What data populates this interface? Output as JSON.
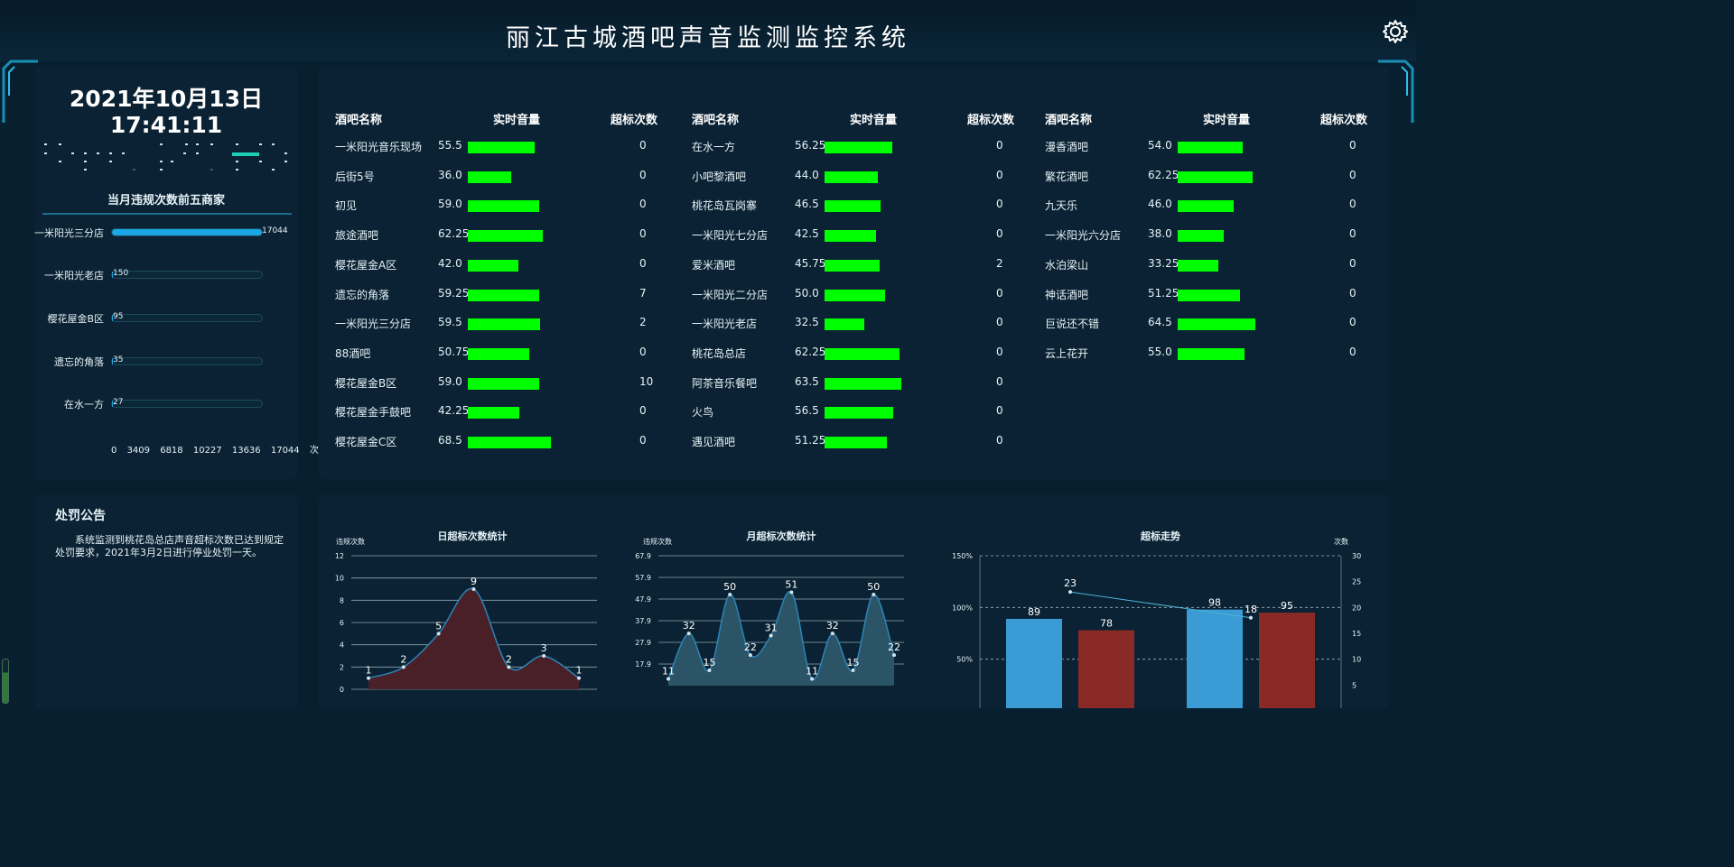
{
  "header": {
    "title": "丽江古城酒吧声音监测监控系统",
    "settings_icon": "gear-icon"
  },
  "clock": {
    "date": "2021年10月13日",
    "time": "17:41:11"
  },
  "top5": {
    "title": "当月违规次数前五商家",
    "items": [
      {
        "name": "一米阳光三分店",
        "value": 17044
      },
      {
        "name": "一米阳光老店",
        "value": 150
      },
      {
        "name": "樱花屋金B区",
        "value": 95
      },
      {
        "name": "遗忘的角落",
        "value": 35
      },
      {
        "name": "在水一方",
        "value": 27
      }
    ],
    "scale": [
      "0",
      "3409",
      "6818",
      "10227",
      "13636",
      "17044",
      "次"
    ]
  },
  "table": {
    "headers": {
      "name": "酒吧名称",
      "volume": "实时音量",
      "count": "超标次数"
    },
    "columns": [
      [
        {
          "name": "一米阳光音乐现场",
          "volume": "55.5",
          "count": "0"
        },
        {
          "name": "后街5号",
          "volume": "36.0",
          "count": "0"
        },
        {
          "name": "初见",
          "volume": "59.0",
          "count": "0"
        },
        {
          "name": "旅途酒吧",
          "volume": "62.25",
          "count": "0"
        },
        {
          "name": "樱花屋金A区",
          "volume": "42.0",
          "count": "0"
        },
        {
          "name": "遗忘的角落",
          "volume": "59.25",
          "count": "7"
        },
        {
          "name": "一米阳光三分店",
          "volume": "59.5",
          "count": "2"
        },
        {
          "name": "88酒吧",
          "volume": "50.75",
          "count": "0"
        },
        {
          "name": "樱花屋金B区",
          "volume": "59.0",
          "count": "10"
        },
        {
          "name": "樱花屋金手鼓吧",
          "volume": "42.25",
          "count": "0"
        },
        {
          "name": "樱花屋金C区",
          "volume": "68.5",
          "count": "0"
        }
      ],
      [
        {
          "name": "在水一方",
          "volume": "56.25",
          "count": "0"
        },
        {
          "name": "小吧黎酒吧",
          "volume": "44.0",
          "count": "0"
        },
        {
          "name": "桃花岛瓦岗寨",
          "volume": "46.5",
          "count": "0"
        },
        {
          "name": "一米阳光七分店",
          "volume": "42.5",
          "count": "0"
        },
        {
          "name": "爱米酒吧",
          "volume": "45.75",
          "count": "2"
        },
        {
          "name": "一米阳光二分店",
          "volume": "50.0",
          "count": "0"
        },
        {
          "name": "一米阳光老店",
          "volume": "32.5",
          "count": "0"
        },
        {
          "name": "桃花岛总店",
          "volume": "62.25",
          "count": "0"
        },
        {
          "name": "阿茶音乐餐吧",
          "volume": "63.5",
          "count": "0"
        },
        {
          "name": "火鸟",
          "volume": "56.5",
          "count": "0"
        },
        {
          "name": "遇见酒吧",
          "volume": "51.25",
          "count": "0"
        }
      ],
      [
        {
          "name": "漫香酒吧",
          "volume": "54.0",
          "count": "0"
        },
        {
          "name": "繁花酒吧",
          "volume": "62.25",
          "count": "0"
        },
        {
          "name": "九天乐",
          "volume": "46.0",
          "count": "0"
        },
        {
          "name": "一米阳光六分店",
          "volume": "38.0",
          "count": "0"
        },
        {
          "name": "水泊梁山",
          "volume": "33.25",
          "count": "0"
        },
        {
          "name": "神话酒吧",
          "volume": "51.25",
          "count": "0"
        },
        {
          "name": "巨说还不错",
          "volume": "64.5",
          "count": "0"
        },
        {
          "name": "云上花开",
          "volume": "55.0",
          "count": "0"
        }
      ]
    ]
  },
  "notice": {
    "title": "处罚公告",
    "body": "系统监测到桃花岛总店声音超标次数已达到规定处罚要求，2021年3月2日进行停业处罚一天。"
  },
  "chart_data": [
    {
      "type": "area",
      "title": "日超标次数统计",
      "ylabel": "违规次数",
      "yticks": [
        "0",
        "2",
        "4",
        "6",
        "8",
        "10",
        "12"
      ],
      "ylim": [
        0,
        12
      ],
      "values": [
        1,
        2,
        5,
        9,
        2,
        3,
        1
      ],
      "color": "#4a2028"
    },
    {
      "type": "area",
      "title": "月超标次数统计",
      "ylabel": "违规次数",
      "yticks": [
        "17.9",
        "27.9",
        "37.9",
        "47.9",
        "57.9",
        "67.9"
      ],
      "ylim": [
        7.9,
        67.9
      ],
      "values": [
        11,
        32,
        15,
        50,
        22,
        31,
        51,
        11,
        32,
        15,
        50,
        22
      ],
      "color": "#2b5566"
    },
    {
      "type": "bar",
      "title": "超标走势",
      "ylabel_right": "次数",
      "yticks_left": [
        "50%",
        "100%",
        "150%"
      ],
      "yticks_right": [
        "5",
        "10",
        "15",
        "20",
        "25",
        "30"
      ],
      "ylim_left": [
        0,
        150
      ],
      "ylim_right": [
        0,
        30
      ],
      "bars": [
        89,
        78,
        98,
        95
      ],
      "bar_colors": [
        "#3a9bd5",
        "#8a2a26",
        "#3a9bd5",
        "#8a2a26"
      ],
      "line": [
        23,
        18
      ]
    }
  ]
}
